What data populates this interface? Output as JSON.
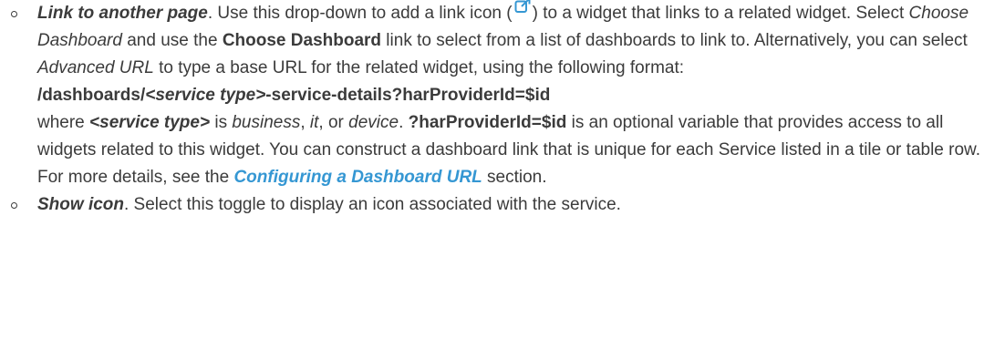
{
  "items": [
    {
      "term": "Link to another page",
      "sentence1_a": ". Use this drop-down to add a link icon (",
      "icon_name": "external-link-icon",
      "sentence1_b": ") to a widget that links to a related widget. Select ",
      "choose_dashboard_italic": "Choose Dashboard",
      "and_use_the": " and use the ",
      "choose_dashboard_bold": "Choose Dashboard",
      "link_to_select": " link to select from a list of dashboards to link to. Alternatively, you can select ",
      "advanced_url": "Advanced URL",
      "to_type": " to type a base URL for the related widget, using the following format:",
      "format_prefix": "/dashboards/",
      "format_placeholder": "<service type>",
      "format_suffix": "-service-details?harProviderId=$id",
      "where": "where ",
      "service_type": "<service type>",
      "is": " is ",
      "business": "business",
      "comma1": ", ",
      "it": "it",
      "comma_or": ", or ",
      "device": "device",
      "period": ". ",
      "param": "?harProviderId=$id",
      "param_desc": " is an optional variable that provides access to all widgets related to this widget. You can construct a dashboard link that is unique for each Service listed in a tile or table row. For more details, see the ",
      "xref": "Configuring a Dashboard URL",
      "section": " section."
    },
    {
      "term": "Show icon",
      "text": ". Select this toggle to display an icon associated with the service."
    }
  ],
  "colors": {
    "text": "#3b3b3b",
    "link": "#3597d3",
    "icon": "#3597d3"
  }
}
